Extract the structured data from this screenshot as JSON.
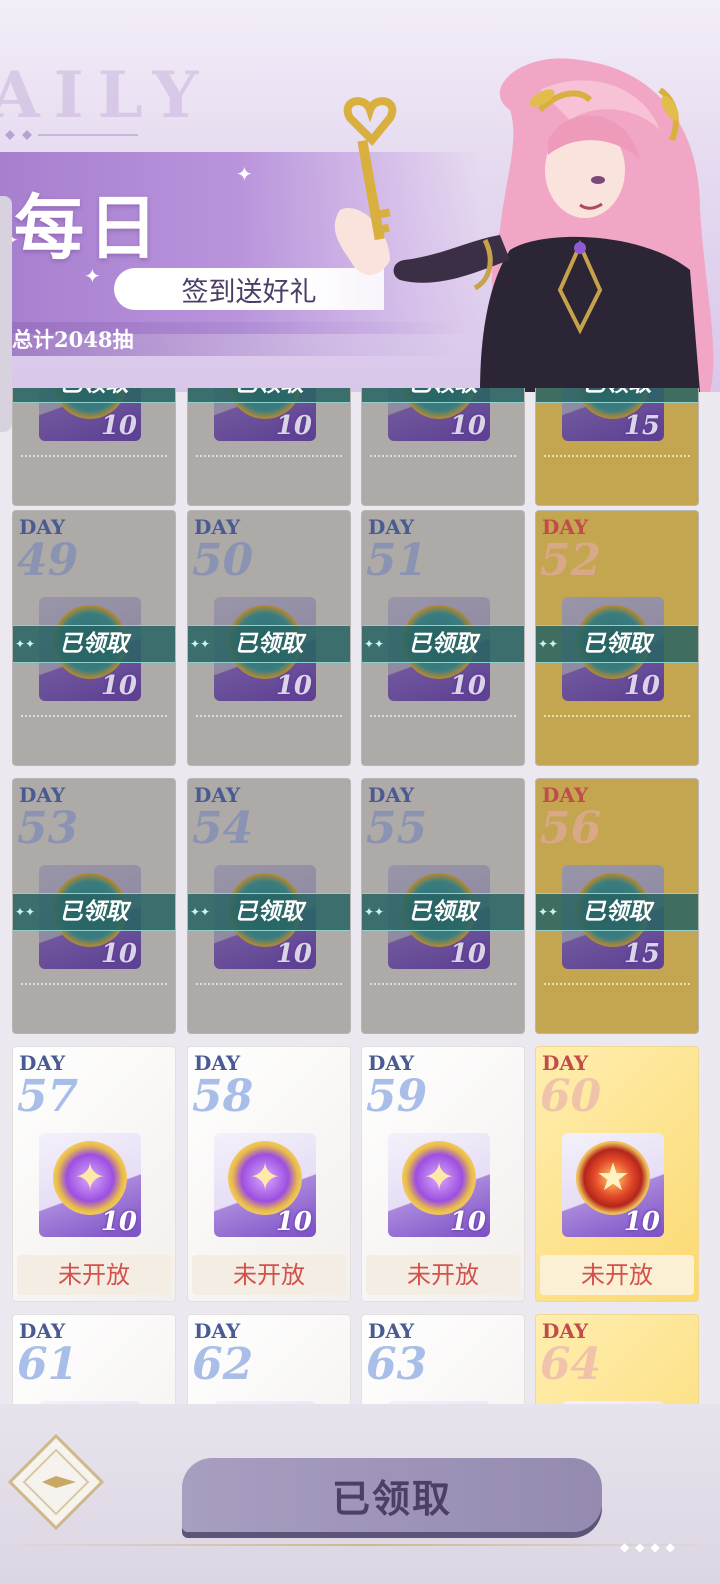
{
  "header": {
    "watermark": "AILY",
    "title": "每日",
    "subtitle": "签到送好礼",
    "total": "总计2048抽"
  },
  "labels": {
    "day": "DAY",
    "claimed": "已领取",
    "not_open": "未开放"
  },
  "rows": [
    {
      "days": [
        "",
        "",
        "",
        ""
      ],
      "qty": [
        "10",
        "10",
        "10",
        "15"
      ],
      "status": "claimed"
    },
    {
      "days": [
        "49",
        "50",
        "51",
        "52"
      ],
      "qty": [
        "10",
        "10",
        "10",
        "10"
      ],
      "status": "claimed"
    },
    {
      "days": [
        "53",
        "54",
        "55",
        "56"
      ],
      "qty": [
        "10",
        "10",
        "10",
        "15"
      ],
      "status": "claimed"
    },
    {
      "days": [
        "57",
        "58",
        "59",
        "60"
      ],
      "qty": [
        "10",
        "10",
        "10",
        "10"
      ],
      "status": "not_open"
    },
    {
      "days": [
        "61",
        "62",
        "63",
        "64"
      ],
      "qty": [
        "",
        "",
        "",
        ""
      ],
      "status": "not_open"
    }
  ],
  "footer": {
    "claim_button": "已领取"
  },
  "colors": {
    "accent_purple": "#a77fcf",
    "claimed_band": "#286464",
    "not_open_text": "#d3514b",
    "gold_card": "#fbd970"
  }
}
